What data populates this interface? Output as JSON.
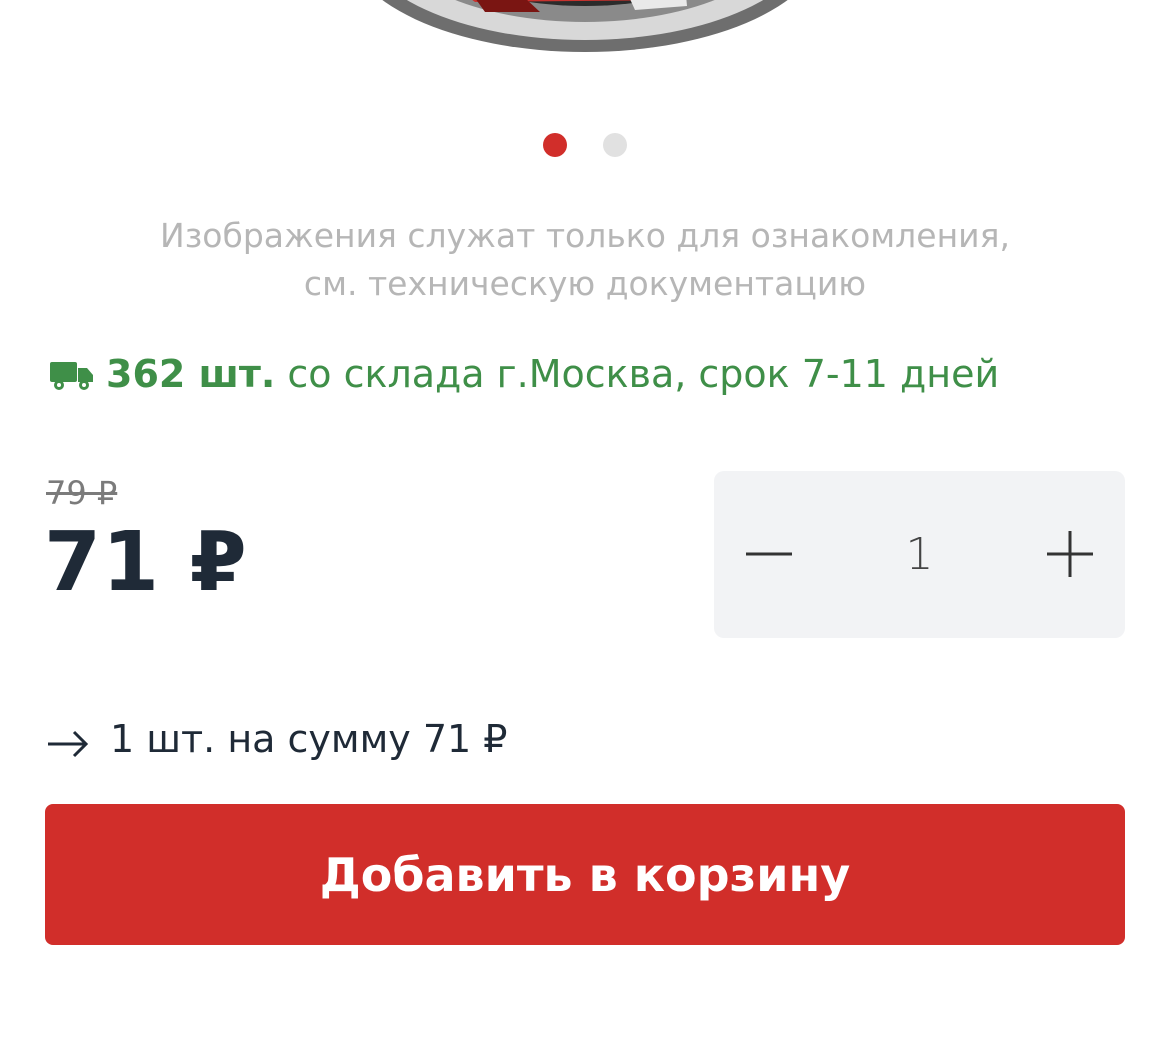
{
  "carousel": {
    "dots": [
      true,
      false
    ]
  },
  "disclaimer": {
    "line1": "Изображения служат только для ознакомления,",
    "line2": "см. техническую документацию"
  },
  "stock": {
    "icon": "truck-icon",
    "quantity": "362 шт.",
    "text": "со склада г.Москва, срок 7-11 дней",
    "color": "#3f8f48"
  },
  "price": {
    "old": "79 ₽",
    "current": "71 ₽"
  },
  "stepper": {
    "value": "1",
    "minus_icon": "minus-icon",
    "plus_icon": "plus-icon"
  },
  "summary": {
    "text": "1 шт. на сумму 71 ₽"
  },
  "cart": {
    "button_label": "Добавить в корзину",
    "color": "#d12e2a"
  }
}
